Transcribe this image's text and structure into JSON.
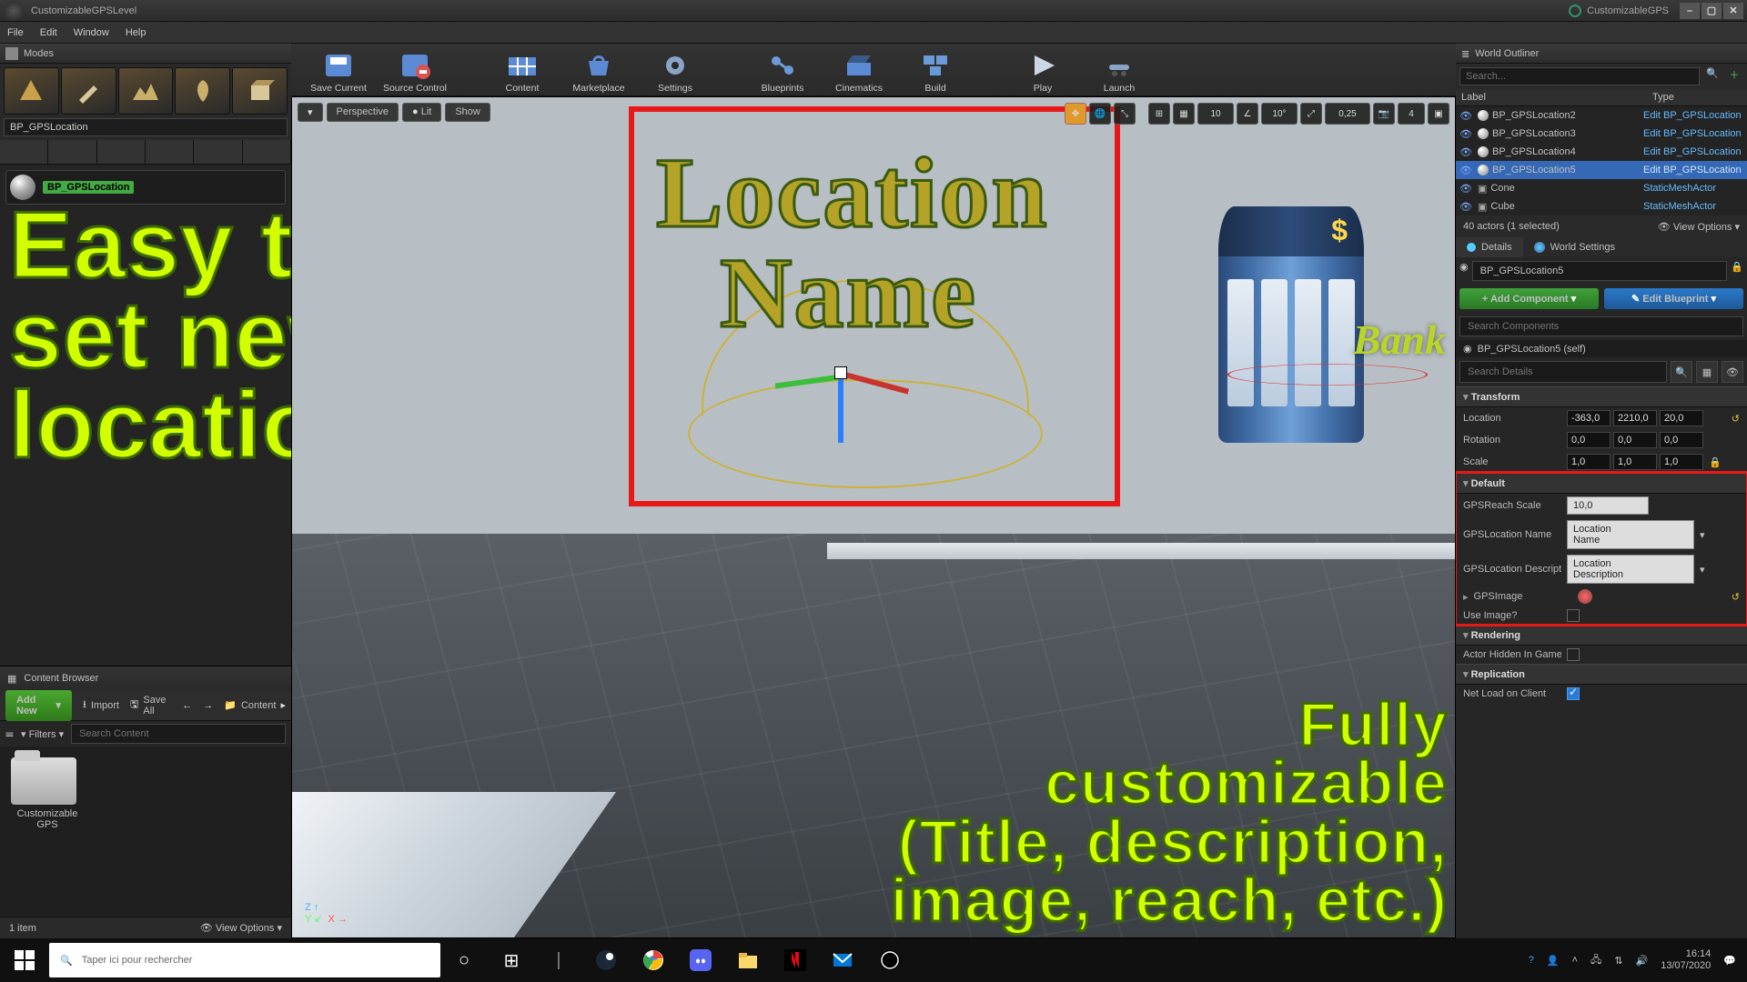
{
  "titlebar": {
    "title": "CustomizableGPSLevel",
    "project": "CustomizableGPS"
  },
  "menu": {
    "file": "File",
    "edit": "Edit",
    "window": "Window",
    "help": "Help"
  },
  "modes": {
    "title": "Modes",
    "search": "BP_GPSLocation",
    "placed_item": "BP_GPSLocation"
  },
  "toolbar": {
    "save": "Save Current",
    "source": "Source Control",
    "content": "Content",
    "market": "Marketplace",
    "settings": "Settings",
    "blueprints": "Blueprints",
    "cinematics": "Cinematics",
    "build": "Build",
    "play": "Play",
    "launch": "Launch"
  },
  "viewport": {
    "perspective": "Perspective",
    "lit": "Lit",
    "show": "Show",
    "snap_move": "10",
    "snap_rot": "10°",
    "snap_scale": "0,25",
    "cam_speed": "4",
    "loc_text_1": "Location",
    "loc_text_2": "Name",
    "bank_label": "Bank"
  },
  "promo": {
    "left": "Easy to\nset new\nlocations",
    "right": "Fully\ncustomizable\n(Title, description,\nimage, reach, etc.)"
  },
  "content_browser": {
    "title": "Content Browser",
    "add_new": "Add New",
    "import": "Import",
    "save_all": "Save All",
    "path": "Content",
    "filters": "Filters",
    "search_ph": "Search Content",
    "folder": "Customizable\nGPS",
    "item_count": "1 item",
    "view_options": "View Options"
  },
  "outliner": {
    "title": "World Outliner",
    "search_ph": "Search...",
    "col_label": "Label",
    "col_type": "Type",
    "rows": [
      {
        "name": "BP_GPSLocation2",
        "type": "Edit BP_GPSLocation"
      },
      {
        "name": "BP_GPSLocation3",
        "type": "Edit BP_GPSLocation"
      },
      {
        "name": "BP_GPSLocation4",
        "type": "Edit BP_GPSLocation"
      },
      {
        "name": "BP_GPSLocation5",
        "type": "Edit BP_GPSLocation"
      },
      {
        "name": "Cone",
        "type": "StaticMeshActor"
      },
      {
        "name": "Cube",
        "type": "StaticMeshActor"
      }
    ],
    "selected_index": 3,
    "footer": "40 actors (1 selected)",
    "view_options": "View Options"
  },
  "details": {
    "tab_details": "Details",
    "tab_world": "World Settings",
    "actor_name": "BP_GPSLocation5",
    "add_component": "+ Add Component",
    "edit_bp": "Edit Blueprint",
    "search_components_ph": "Search Components",
    "root_component": "BP_GPSLocation5 (self)",
    "search_details_ph": "Search Details",
    "cat_transform": "Transform",
    "loc_label": "Location",
    "loc": [
      "-363,0",
      "2210,0",
      "20,0"
    ],
    "rot_label": "Rotation",
    "rot": [
      "0,0",
      "0,0",
      "0,0"
    ],
    "scale_label": "Scale",
    "scale": [
      "1,0",
      "1,0",
      "1,0"
    ],
    "cat_default": "Default",
    "gps_reach_label": "GPSReach Scale",
    "gps_reach": "10,0",
    "gps_name_label": "GPSLocation Name",
    "gps_name": "Location\nName",
    "gps_desc_label": "GPSLocation Description",
    "gps_desc": "Location\nDescription",
    "gps_image_label": "GPSImage",
    "use_image_label": "Use Image?",
    "cat_render": "Rendering",
    "actor_hidden_label": "Actor Hidden In Game",
    "cat_repl": "Replication",
    "net_load_label": "Net Load on Client"
  },
  "taskbar": {
    "search_ph": "Taper ici pour rechercher",
    "time": "16:14",
    "date": "13/07/2020"
  }
}
